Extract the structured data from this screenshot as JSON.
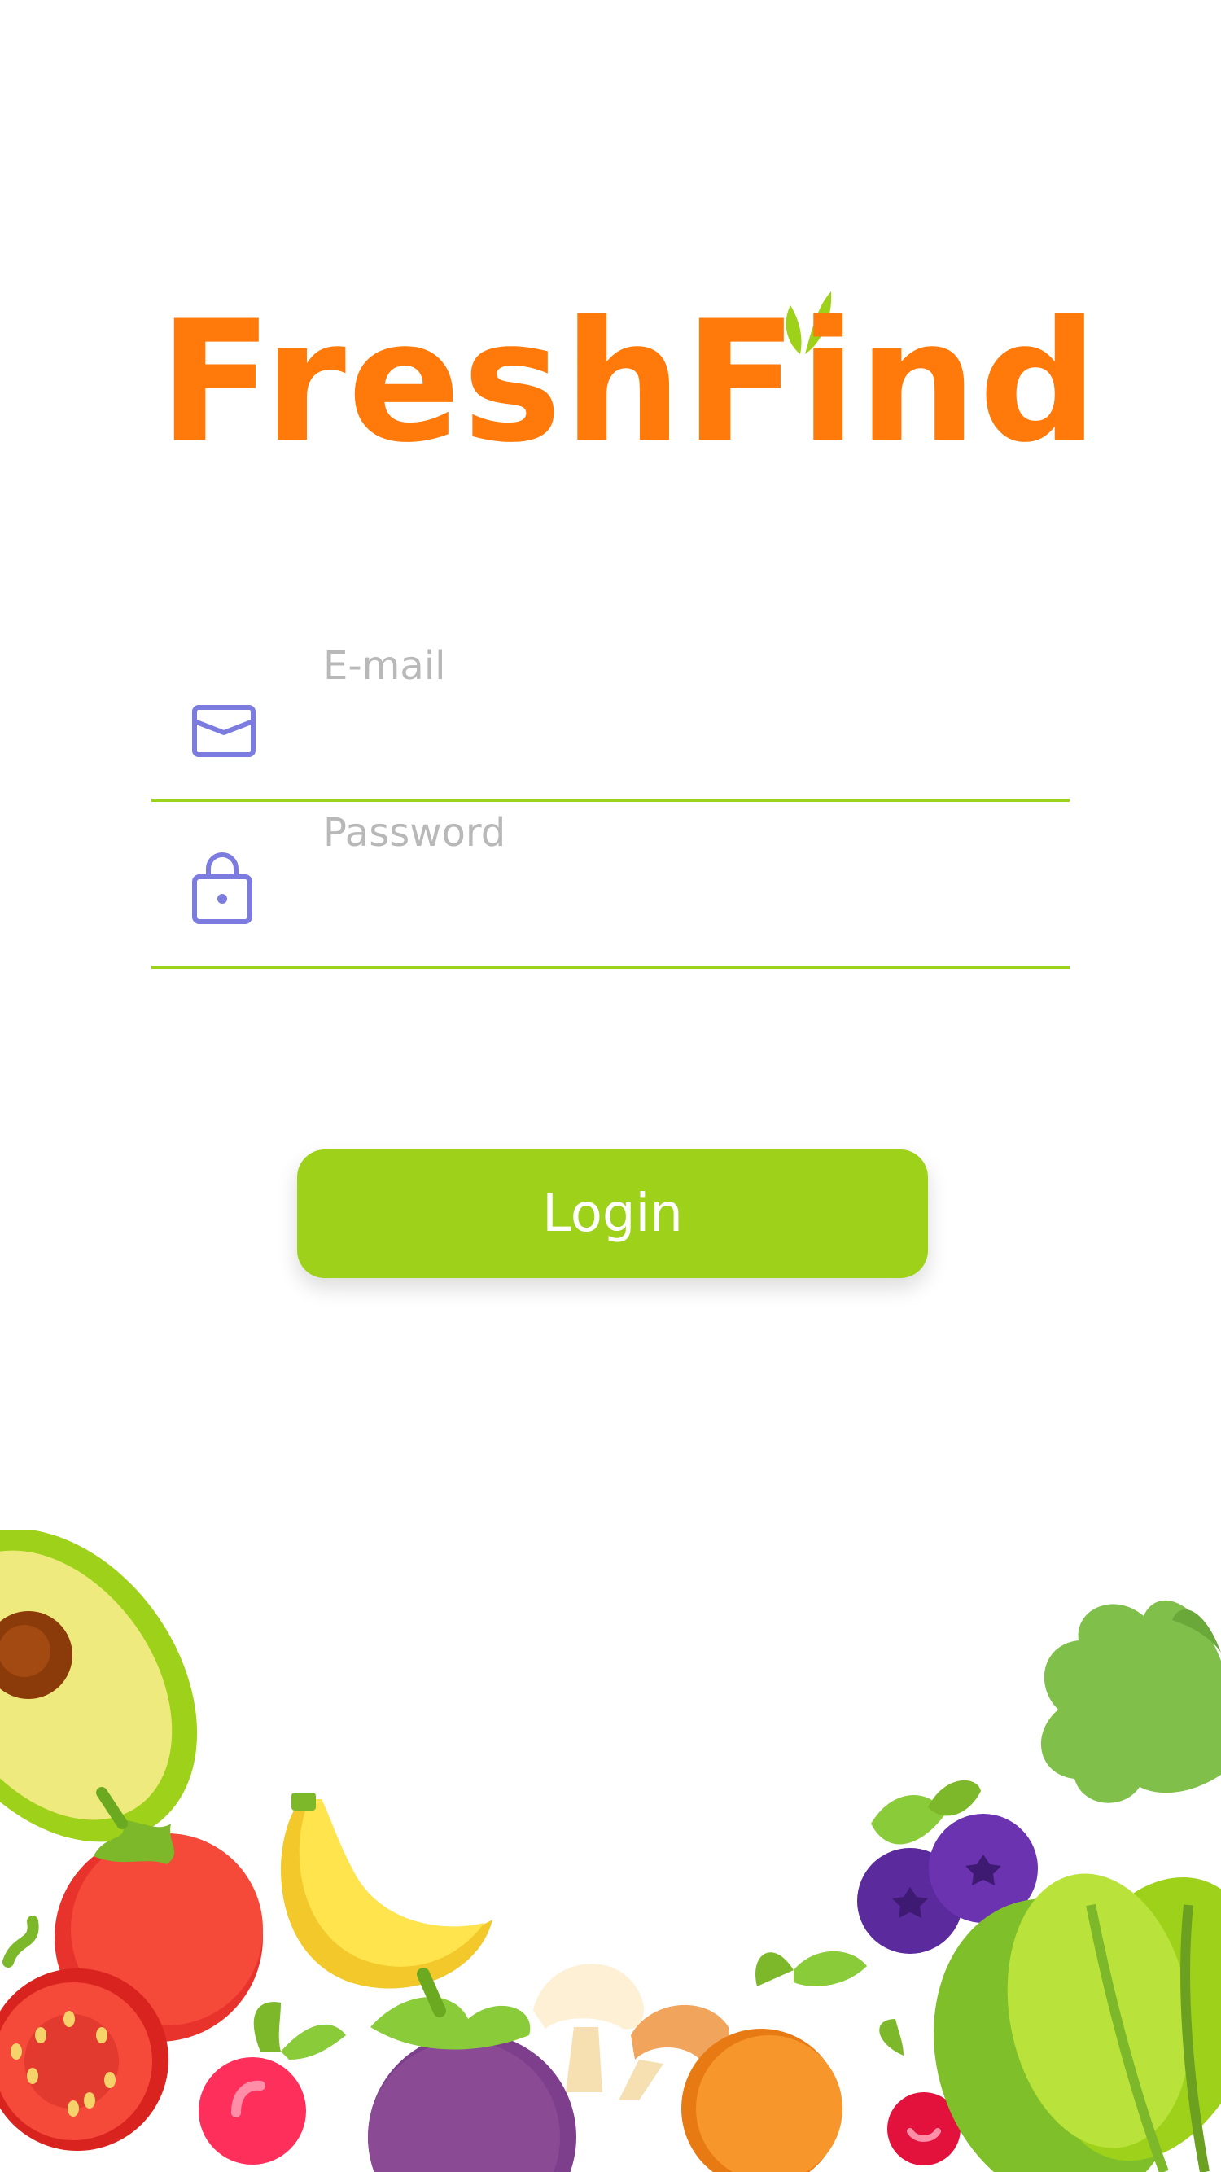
{
  "app": {
    "logo_text": "FreshFind"
  },
  "form": {
    "email_label": "E-mail",
    "email_value": "",
    "password_label": "Password",
    "password_value": "",
    "login_label": "Login"
  },
  "icons": {
    "email": "envelope-icon",
    "password": "lock-icon"
  },
  "colors": {
    "brand_orange": "#FF7A0A",
    "accent_green": "#9ED11A",
    "icon_purple": "#7B7BE0",
    "label_gray": "#B8B8B8",
    "background": "#FFFFFF"
  }
}
